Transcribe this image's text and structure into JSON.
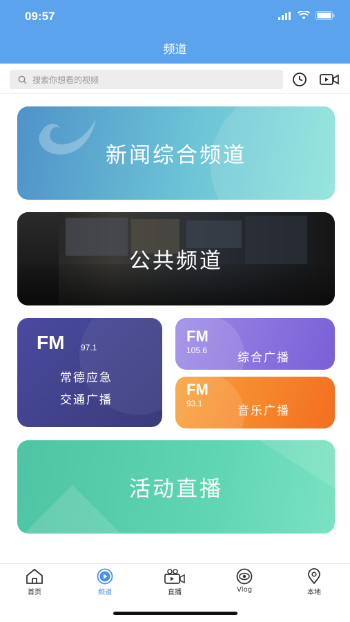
{
  "status": {
    "time": "09:57"
  },
  "nav": {
    "title": "频道"
  },
  "search": {
    "placeholder": "搜索你想看的视频"
  },
  "cards": {
    "news": "新闻综合频道",
    "public": "公共频道",
    "live": "活动直播"
  },
  "radio": {
    "big": {
      "band": "FM",
      "freq": "97.1",
      "name_line1": "常德应急",
      "name_line2": "交通广播"
    },
    "small1": {
      "band": "FM",
      "freq": "105.6",
      "name": "综合广播"
    },
    "small2": {
      "band": "FM",
      "freq": "93.1",
      "name": "音乐广播"
    }
  },
  "tabs": [
    {
      "label": "首页",
      "icon": "home-icon"
    },
    {
      "label": "频道",
      "icon": "play-circle-icon"
    },
    {
      "label": "直播",
      "icon": "video-camera-icon"
    },
    {
      "label": "Vlog",
      "icon": "vlog-icon"
    },
    {
      "label": "本地",
      "icon": "location-pin-icon"
    }
  ],
  "colors": {
    "accent": "#5ba3ec",
    "active_tab": "#4a8ff0"
  }
}
